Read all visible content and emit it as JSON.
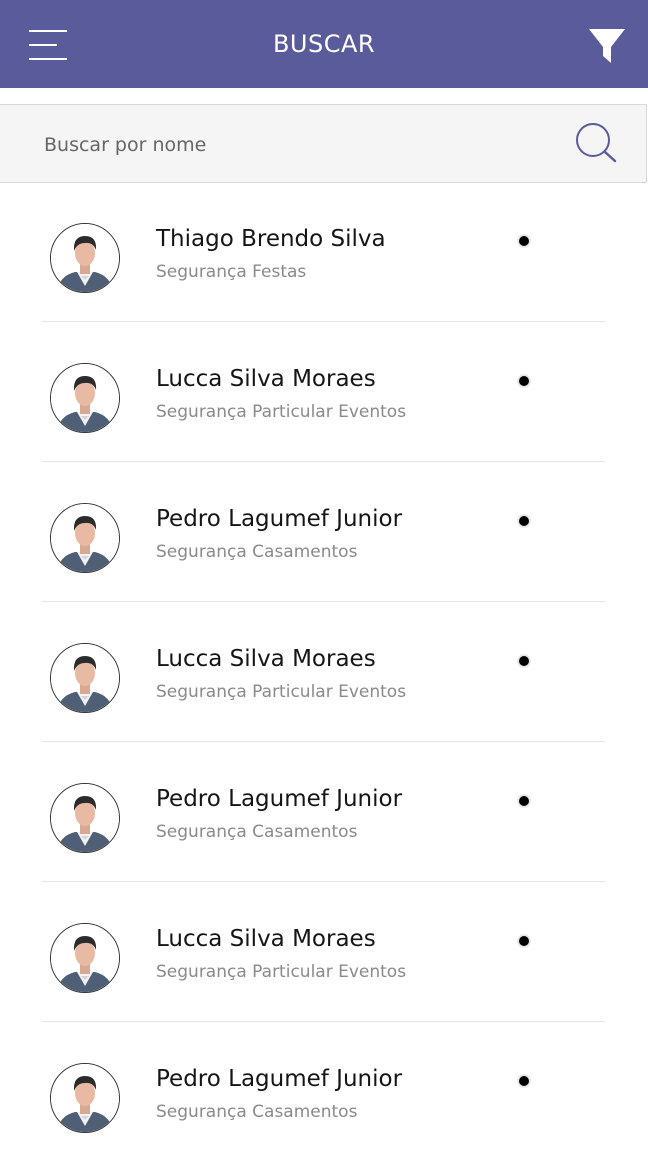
{
  "header": {
    "title": "BUSCAR",
    "menu_icon": "hamburger-menu-icon",
    "filter_icon": "funnel-filter-icon",
    "background_color": "#5a5b9a"
  },
  "search": {
    "placeholder": "Buscar por nome",
    "value": "",
    "icon": "search-icon"
  },
  "results": [
    {
      "name": "Thiago Brendo Silva",
      "role": "Segurança Festas",
      "status": "online"
    },
    {
      "name": "Lucca Silva Moraes",
      "role": "Segurança Particular Eventos",
      "status": "online"
    },
    {
      "name": "Pedro Lagumef Junior",
      "role": "Segurança Casamentos",
      "status": "online"
    },
    {
      "name": "Lucca Silva Moraes",
      "role": "Segurança Particular Eventos",
      "status": "online"
    },
    {
      "name": "Pedro Lagumef Junior",
      "role": "Segurança Casamentos",
      "status": "online"
    },
    {
      "name": "Lucca Silva Moraes",
      "role": "Segurança Particular Eventos",
      "status": "online"
    },
    {
      "name": "Pedro Lagumef Junior",
      "role": "Segurança Casamentos",
      "status": "online"
    }
  ]
}
